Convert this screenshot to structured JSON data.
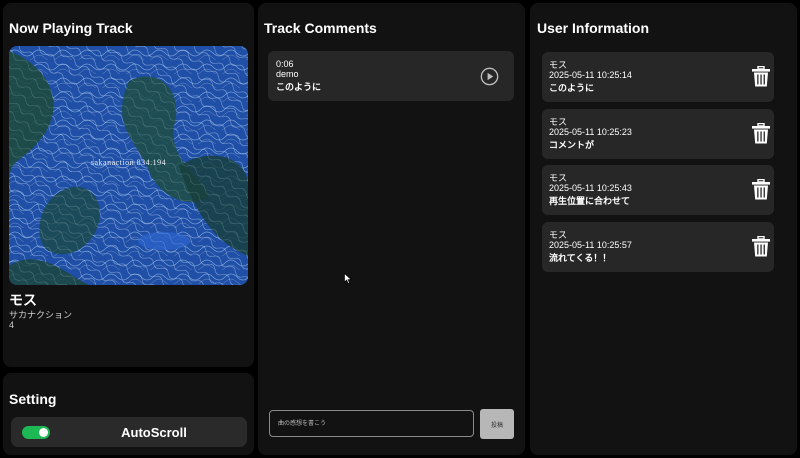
{
  "now_playing": {
    "title": "Now Playing Track",
    "art_text": "sakanaction   834.194",
    "track_title": "モス",
    "artist": "サカナクション",
    "track_number": "4"
  },
  "setting": {
    "title": "Setting",
    "autoscroll_label": "AutoScroll",
    "autoscroll_on": true,
    "toggle_color": "#1db954"
  },
  "comments": {
    "title": "Track Comments",
    "items": [
      {
        "time": "0:06",
        "user": "demo",
        "text": "このように",
        "action_icon": "play-circle-icon"
      }
    ],
    "input_placeholder": "曲の感想を書こう",
    "post_label": "投稿"
  },
  "user_info": {
    "title": "User Information",
    "items": [
      {
        "name": "モス",
        "timestamp": "2025-05-11 10:25:14",
        "text": "このように",
        "action_icon": "trash-icon"
      },
      {
        "name": "モス",
        "timestamp": "2025-05-11 10:25:23",
        "text": "コメントが",
        "action_icon": "trash-icon"
      },
      {
        "name": "モス",
        "timestamp": "2025-05-11 10:25:43",
        "text": "再生位置に合わせて",
        "action_icon": "trash-icon"
      },
      {
        "name": "モス",
        "timestamp": "2025-05-11 10:25:57",
        "text": "流れてくる！！",
        "action_icon": "trash-icon"
      }
    ]
  }
}
